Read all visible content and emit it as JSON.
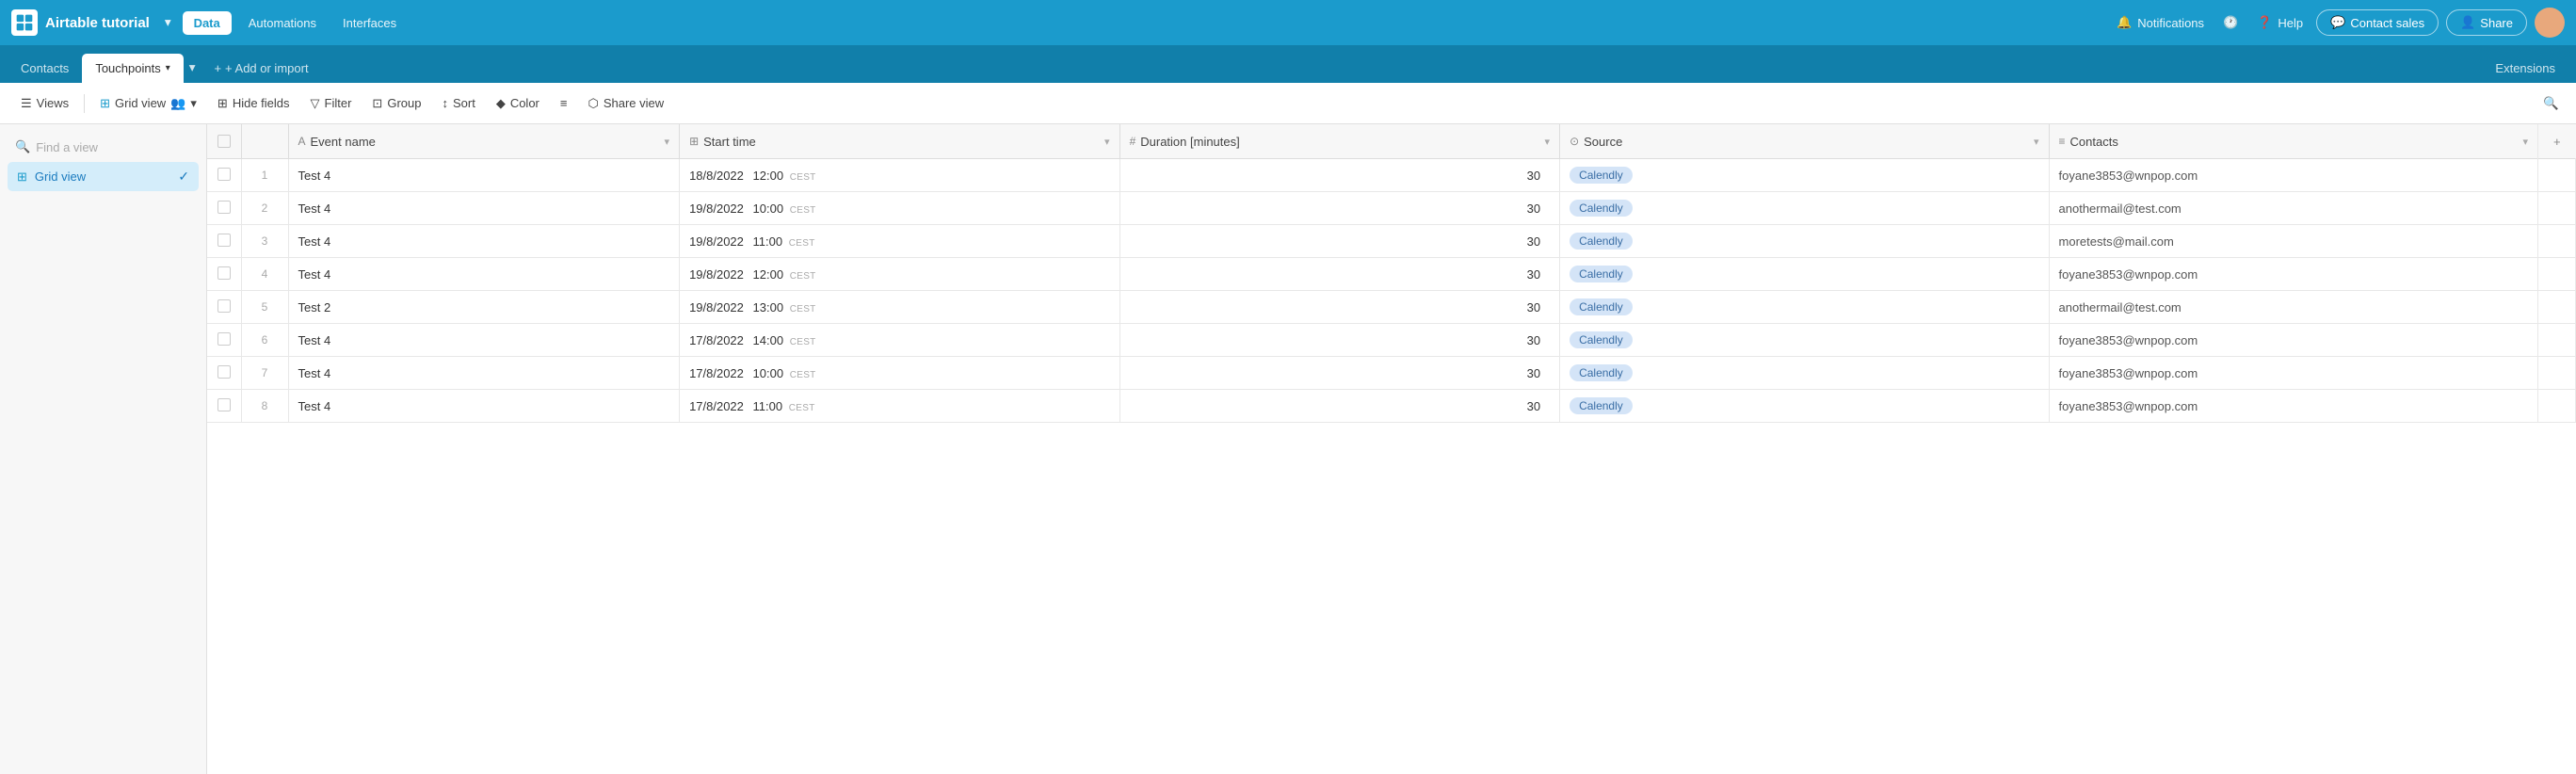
{
  "app": {
    "name": "Airtable tutorial",
    "logo_alt": "Airtable"
  },
  "topnav": {
    "data_label": "Data",
    "automations_label": "Automations",
    "interfaces_label": "Interfaces",
    "notifications_label": "Notifications",
    "help_label": "Help",
    "contact_sales_label": "Contact sales",
    "share_label": "Share"
  },
  "tabs": {
    "contacts_label": "Contacts",
    "touchpoints_label": "Touchpoints",
    "add_label": "+ Add or import",
    "extensions_label": "Extensions"
  },
  "toolbar": {
    "views_label": "Views",
    "grid_view_label": "Grid view",
    "hide_fields_label": "Hide fields",
    "filter_label": "Filter",
    "group_label": "Group",
    "sort_label": "Sort",
    "color_label": "Color",
    "row_height_label": "≡",
    "share_view_label": "Share view"
  },
  "sidebar": {
    "search_placeholder": "Find a view",
    "grid_view_label": "Grid view"
  },
  "table": {
    "columns": [
      {
        "id": "event_name",
        "label": "Event name",
        "icon": "A"
      },
      {
        "id": "start_time",
        "label": "Start time",
        "icon": "⊞"
      },
      {
        "id": "duration",
        "label": "Duration [minutes]",
        "icon": "#"
      },
      {
        "id": "source",
        "label": "Source",
        "icon": "⊙"
      },
      {
        "id": "contacts",
        "label": "Contacts",
        "icon": "≡"
      }
    ],
    "rows": [
      {
        "num": 1,
        "event_name": "Test 4",
        "date": "18/8/2022",
        "time": "12:00",
        "tz": "CEST",
        "duration": 30,
        "source": "Calendly",
        "contact": "foyane3853@wnpop.com"
      },
      {
        "num": 2,
        "event_name": "Test 4",
        "date": "19/8/2022",
        "time": "10:00",
        "tz": "CEST",
        "duration": 30,
        "source": "Calendly",
        "contact": "anothermail@test.com"
      },
      {
        "num": 3,
        "event_name": "Test 4",
        "date": "19/8/2022",
        "time": "11:00",
        "tz": "CEST",
        "duration": 30,
        "source": "Calendly",
        "contact": "moretests@mail.com"
      },
      {
        "num": 4,
        "event_name": "Test 4",
        "date": "19/8/2022",
        "time": "12:00",
        "tz": "CEST",
        "duration": 30,
        "source": "Calendly",
        "contact": "foyane3853@wnpop.com"
      },
      {
        "num": 5,
        "event_name": "Test 2",
        "date": "19/8/2022",
        "time": "13:00",
        "tz": "CEST",
        "duration": 30,
        "source": "Calendly",
        "contact": "anothermail@test.com"
      },
      {
        "num": 6,
        "event_name": "Test 4",
        "date": "17/8/2022",
        "time": "14:00",
        "tz": "CEST",
        "duration": 30,
        "source": "Calendly",
        "contact": "foyane3853@wnpop.com"
      },
      {
        "num": 7,
        "event_name": "Test 4",
        "date": "17/8/2022",
        "time": "10:00",
        "tz": "CEST",
        "duration": 30,
        "source": "Calendly",
        "contact": "foyane3853@wnpop.com"
      },
      {
        "num": 8,
        "event_name": "Test 4",
        "date": "17/8/2022",
        "time": "11:00",
        "tz": "CEST",
        "duration": 30,
        "source": "Calendly",
        "contact": "foyane3853@wnpop.com"
      }
    ]
  }
}
